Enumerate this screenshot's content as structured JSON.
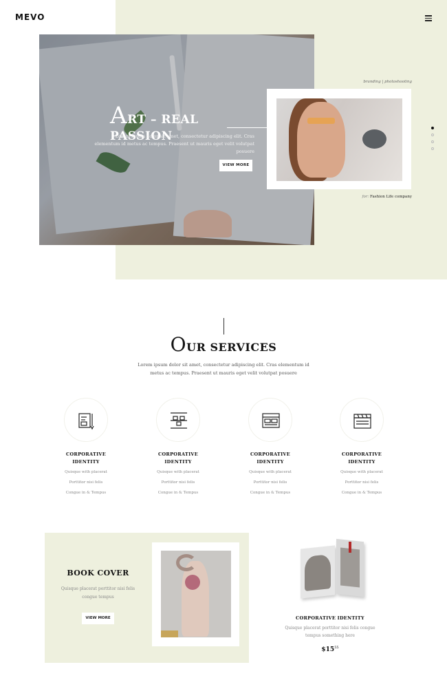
{
  "header": {
    "logo": "MEVO",
    "menu_icon": "hamburger-icon"
  },
  "hero": {
    "title_cap": "A",
    "title_rest": "RT – REAL PASSION",
    "subtitle": "Lorem ipsum dolor sit amet, consectetur adipiscing elit. Cras elementum id metus ac tempus. Praesent ut mauris eget velit volutpat posuere",
    "button_label": "VIEW MORE",
    "branding_tag": "branding | photoshooting",
    "for_prefix": "for:",
    "for_company": "Fashion Life company",
    "slider_dots": 4
  },
  "services": {
    "title_cap": "O",
    "title_rest": "UR SERVICES",
    "description": "Lorem ipsum dolor sit amet, consectetur adipiscing elit. Cras elementum id metus ac tempus. Praesent ut mauris eget velit volutpat posuere",
    "items": [
      {
        "icon": "document-pen-icon",
        "name_line1": "CORPORATIVE",
        "name_line2": "IDENTITY",
        "lines": [
          "Quisque with placerat",
          "Porttitor nisi felis",
          "Congue in & Tempus"
        ]
      },
      {
        "icon": "structure-icon",
        "name_line1": "CORPORATIVE",
        "name_line2": "IDENTITY",
        "lines": [
          "Quisque with placerat",
          "Porttitor nisi felis",
          "Congue in & Tempus"
        ]
      },
      {
        "icon": "browser-window-icon",
        "name_line1": "CORPORATIVE",
        "name_line2": "IDENTITY",
        "lines": [
          "Quisque with placerat",
          "Porttitor nisi felis",
          "Congue in & Tempus"
        ]
      },
      {
        "icon": "clapperboard-icon",
        "name_line1": "CORPORATIVE",
        "name_line2": "IDENTITY",
        "lines": [
          "Quisque with placerat",
          "Porttitor nisi felis",
          "Congue in & Tempus"
        ]
      }
    ]
  },
  "book": {
    "title": "BOOK COVER",
    "description": "Quisque placerat porttitor nisi felis congue tempus",
    "button_label": "VIEW MORE"
  },
  "product": {
    "name": "CORPORATIVE IDENTITY",
    "description": "Quisque placerat porttitor nisi felis congue tempus something here",
    "price_main": "$15",
    "price_cents": "55"
  },
  "colors": {
    "accent_bg": "#eef0de",
    "text_dark": "#111111",
    "text_muted": "#888888"
  }
}
